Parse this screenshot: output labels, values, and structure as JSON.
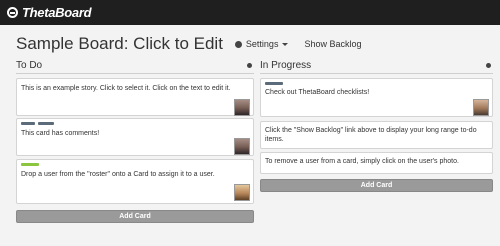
{
  "app": {
    "name": "ThetaBoard"
  },
  "header": {
    "title": "Sample Board: Click to Edit",
    "settings_label": "Settings",
    "backlog_label": "Show Backlog"
  },
  "columns": [
    {
      "title": "To Do",
      "add_card_label": "Add Card",
      "cards": [
        {
          "text": "This is an example story. Click to select it. Click on the text to edit it.",
          "tags": []
        },
        {
          "text": "This card has comments!",
          "tags": [
            "#5b6b7a",
            "#5b6b7a"
          ]
        },
        {
          "text": "Drop a user from the \"roster\" onto a Card to assign it to a user.",
          "tags": [
            "#8cc63f"
          ]
        }
      ]
    },
    {
      "title": "In Progress",
      "add_card_label": "Add Card",
      "cards": [
        {
          "text": "Check out ThetaBoard checklists!",
          "tags": [
            "#5b6b7a"
          ]
        },
        {
          "text": "Click the \"Show Backlog\" link above to display your long range to-do items.",
          "tags": []
        },
        {
          "text": "To remove a user from a card, simply click on the user's photo.",
          "tags": []
        }
      ]
    }
  ]
}
